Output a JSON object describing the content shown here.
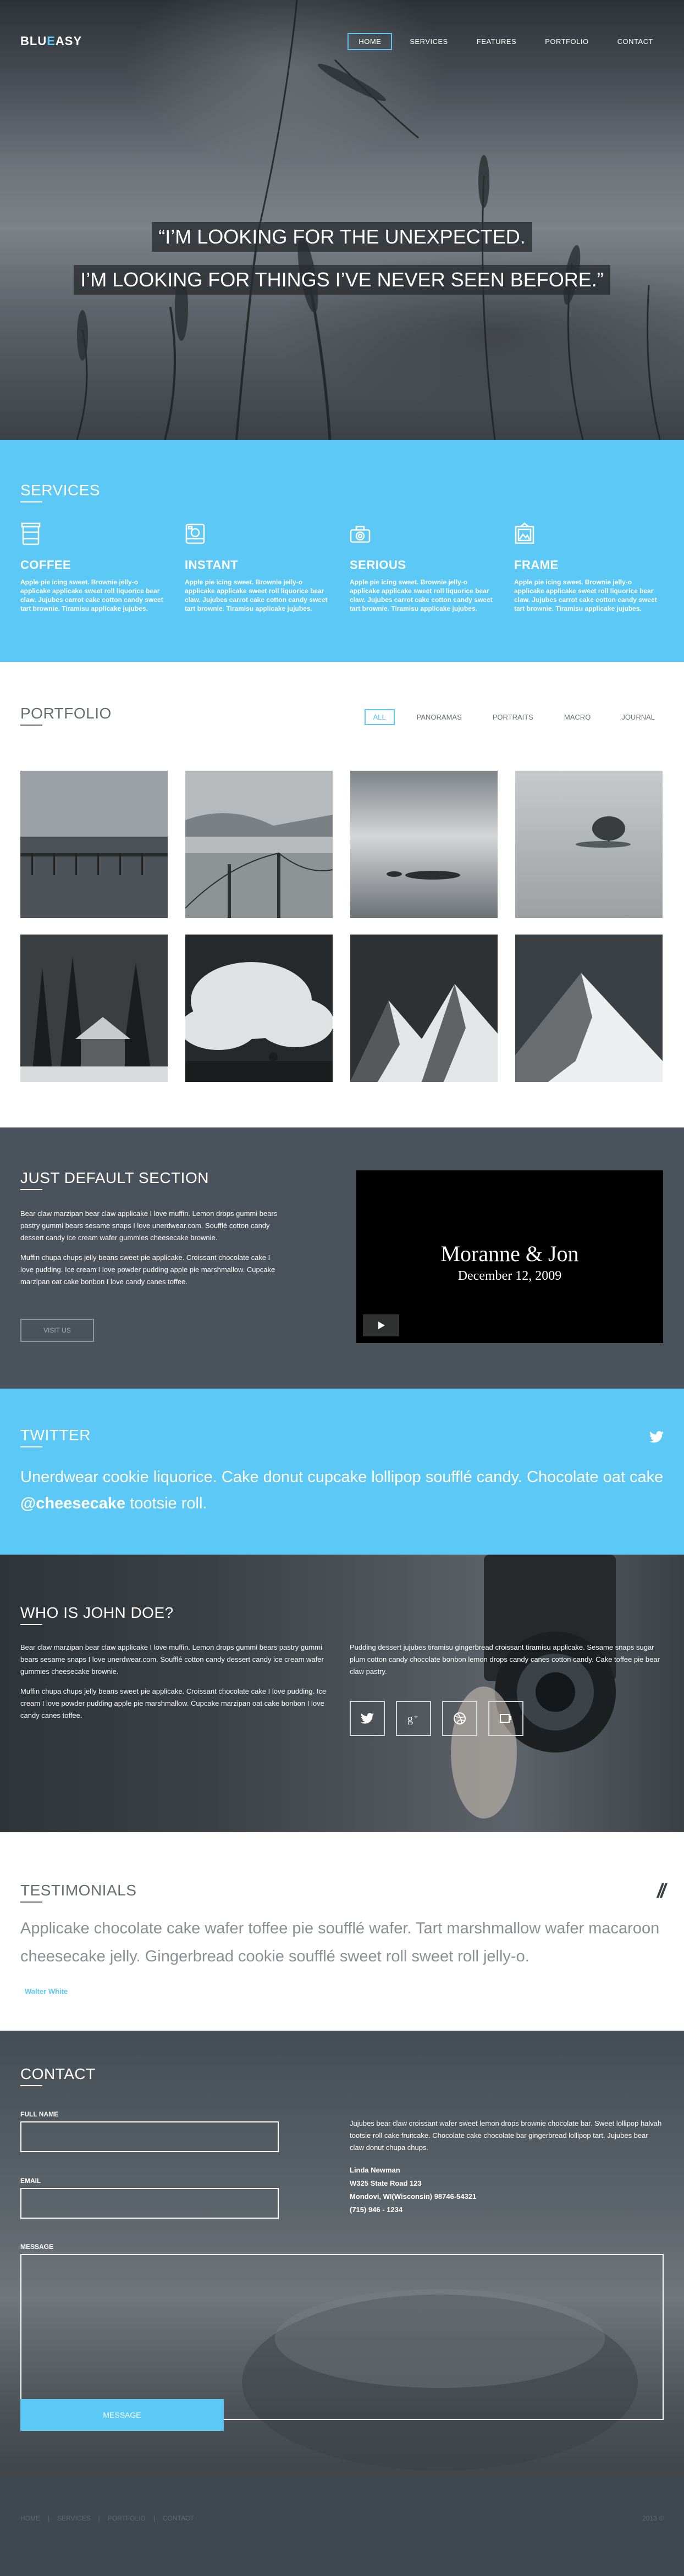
{
  "header": {
    "logo_pre": "BLU",
    "logo_e": "E",
    "logo_post": "ASY",
    "nav": [
      "HOME",
      "SERVICES",
      "FEATURES",
      "PORTFOLIO",
      "CONTACT"
    ]
  },
  "hero": {
    "line1": "“I’M LOOKING FOR THE UNEXPECTED.",
    "line2": "I’M LOOKING FOR THINGS I’VE NEVER SEEN BEFORE.”"
  },
  "services": {
    "title": "SERVICES",
    "items": [
      {
        "title": "COFFEE",
        "icon": "coffee-cup-icon",
        "text": "Apple pie icing sweet. Brownie jelly-o applicake applicake sweet roll liquorice bear claw. Jujubes carrot cake cotton candy sweet tart brownie. Tiramisu applicake jujubes."
      },
      {
        "title": "INSTANT",
        "icon": "instant-camera-icon",
        "text": "Apple pie icing sweet. Brownie jelly-o applicake applicake sweet roll liquorice bear claw. Jujubes carrot cake cotton candy sweet tart brownie. Tiramisu applicake jujubes."
      },
      {
        "title": "SERIOUS",
        "icon": "camera-icon",
        "text": "Apple pie icing sweet. Brownie jelly-o applicake applicake sweet roll liquorice bear claw. Jujubes carrot cake cotton candy sweet tart brownie. Tiramisu applicake jujubes."
      },
      {
        "title": "FRAME",
        "icon": "picture-frame-icon",
        "text": "Apple pie icing sweet. Brownie jelly-o applicake applicake sweet roll liquorice bear claw. Jujubes carrot cake cotton candy sweet tart brownie. Tiramisu applicake jujubes."
      }
    ]
  },
  "portfolio": {
    "title": "PORTFOLIO",
    "filters": [
      "ALL",
      "PANORAMAS",
      "PORTRAITS",
      "MACRO",
      "JOURNAL"
    ],
    "active_filter": "ALL"
  },
  "default_section": {
    "title": "JUST DEFAULT SECTION",
    "p1": "Bear claw marzipan bear claw applicake I love muffin. Lemon drops gummi bears pastry gummi bears sesame snaps I love unerdwear.com. Soufflé cotton candy dessert candy ice cream wafer gummies cheesecake brownie.",
    "p2": "Muffin chupa chups jelly beans sweet pie applicake. Croissant chocolate cake I love pudding. Ice cream I love powder pudding apple pie marshmallow. Cupcake marzipan oat cake bonbon I love candy canes toffee.",
    "button": "VISIT US",
    "video_title": "Moranne & Jon",
    "video_date": "December 12, 2009"
  },
  "twitter": {
    "title": "TWITTER",
    "tweet_text": "Unerdwear cookie liquorice. Cake donut cupcake lollipop soufflé candy. Chocolate oat cake",
    "tweet_handle": "@cheesecake",
    "tweet_end": " tootsie roll."
  },
  "john": {
    "title": "WHO IS JOHN DOE?",
    "p1": "Bear claw marzipan bear claw applicake I love muffin. Lemon drops gummi bears pastry gummi bears sesame snaps I love unerdwear.com. Soufflé cotton candy dessert candy ice cream wafer gummies cheesecake brownie.",
    "p2": "Muffin chupa chups jelly beans sweet pie applicake. Croissant chocolate cake I love pudding. Ice cream I love powder pudding apple pie marshmallow. Cupcake marzipan oat cake bonbon I love candy canes toffee.",
    "p3": "Pudding dessert jujubes tiramisu gingerbread croissant tiramisu applicake. Sesame snaps sugar plum cotton candy chocolate bonbon lemon drops candy canes cotton candy. Cake toffee pie bear claw pastry."
  },
  "testimonials": {
    "title": "TESTIMONIALS",
    "quote": "Applicake chocolate cake wafer toffee pie soufflé wafer. Tart marshmallow wafer macaroon cheesecake jelly. Gingerbread cookie soufflé sweet roll sweet roll jelly-o.",
    "author": "Walter White",
    "quote_mark": "//"
  },
  "contact": {
    "title": "CONTACT",
    "name_label": "FULL NAME",
    "email_label": "EMAIL",
    "message_label": "MESSAGE",
    "send": "MESSAGE",
    "info": "Jujubes bear claw croissant wafer sweet lemon drops brownie chocolate bar. Sweet lollipop halvah tootsie roll cake fruitcake. Chocolate cake chocolate bar gingerbread lollipop tart. Jujubes bear claw donut chupa chups.",
    "addr_name": "Linda Newman",
    "addr_street": "W325 State Road 123",
    "addr_city": "Mondovi, WI(Wisconsin) 98746-54321",
    "addr_phone": "(715) 946 - 1234"
  },
  "footer": {
    "links": [
      "HOME",
      "SERVICES",
      "PORTFOLIO",
      "CONTACT"
    ],
    "copyright": "2013 ©"
  },
  "colors": {
    "accent": "#5bc8f5",
    "dark": "#4a535c",
    "footer": "#3f4851"
  }
}
